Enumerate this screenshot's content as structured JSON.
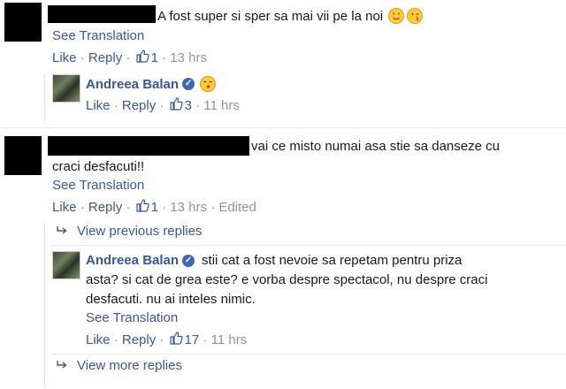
{
  "comment1": {
    "text": "A fost super si sper sa mai vii pe la noi",
    "emoji": [
      "heart-eyes-emoji",
      "wink-kiss-emoji"
    ],
    "see_translation": "See Translation",
    "like": "Like",
    "reply": "Reply",
    "reactions": "1",
    "time": "13 hrs"
  },
  "reply1": {
    "author": "Andreea Balan",
    "emoji": "kiss-emoji",
    "like": "Like",
    "reply": "Reply",
    "reactions": "3",
    "time": "11 hrs"
  },
  "comment2": {
    "text_line1": "vai ce misto numai asa stie sa danseze cu",
    "text_line2": "craci desfacuti!!",
    "see_translation": "See Translation",
    "like": "Like",
    "reply": "Reply",
    "reactions": "1",
    "time": "13 hrs",
    "edited": "Edited",
    "view_previous": "View previous replies"
  },
  "reply2": {
    "author": "Andreea Balan",
    "text_line1": "stii cat a fost nevoie sa repetam pentru priza",
    "text_line2": "asta? si cat de grea este? e vorba despre spectacol, nu despre craci",
    "text_line3": "desfacuti. nu ai inteles nimic.",
    "see_translation": "See Translation",
    "like": "Like",
    "reply": "Reply",
    "reactions": "17",
    "time": "11 hrs",
    "view_more": "View more replies"
  },
  "colors": {
    "link": "#365899",
    "muted": "#90949c",
    "redaction": "#000000"
  }
}
